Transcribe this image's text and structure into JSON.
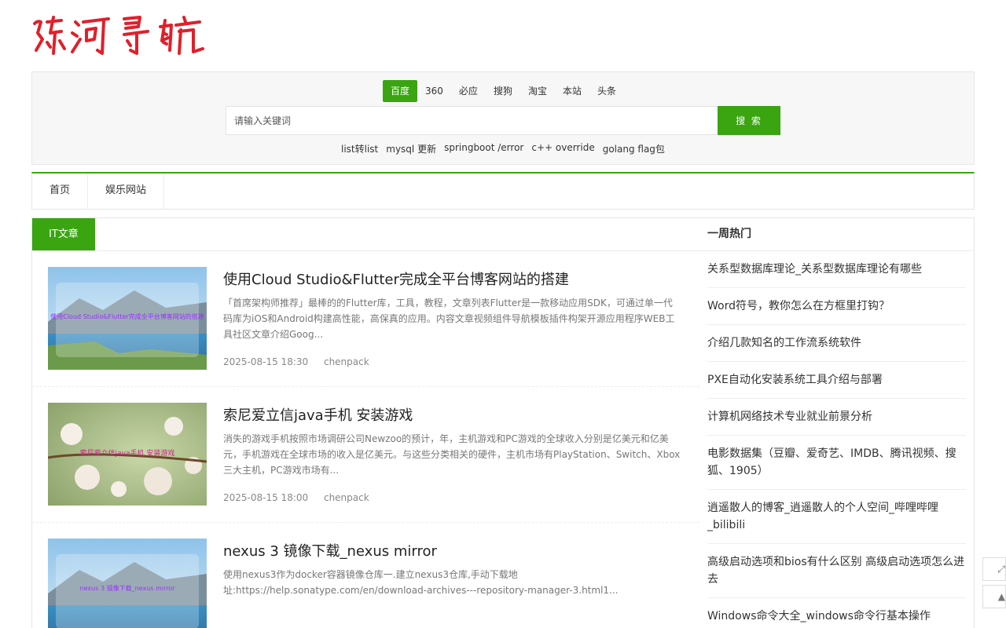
{
  "logo": {
    "text": "陈河导航",
    "color": "#e0202a"
  },
  "search": {
    "engines": [
      "百度",
      "360",
      "必应",
      "搜狗",
      "淘宝",
      "本站",
      "头条"
    ],
    "active_engine": 0,
    "placeholder": "请输入关键词",
    "button_label": "搜 索",
    "hot_keywords": [
      "list转list",
      "mysql 更新",
      "springboot /error",
      "c++ override",
      "golang flag包"
    ]
  },
  "nav": {
    "items": [
      "首页",
      "娱乐网站"
    ]
  },
  "main": {
    "tab_label": "IT文章",
    "articles": [
      {
        "title": "使用Cloud Studio&Flutter完成全平台博客网站的搭建",
        "desc": "「首席架构师推荐」最棒的的Flutter库，工具，教程，文章列表Flutter是一款移动应用SDK，可通过单一代码库为iOS和Android构建高性能，高保真的应用。内容文章视频组件导航模板插件构架开源应用程序WEB工具社区文章介绍Goog...",
        "date": "2025-08-15 18:30",
        "author": "chenpack",
        "thumb_label": "使用Cloud Studio&Flutter完成全平台博客网站的搭建"
      },
      {
        "title": "索尼爱立信java手机 安装游戏",
        "desc": "消失的游戏手机按照市场调研公司Newzoo的预计，年，主机游戏和PC游戏的全球收入分别是亿美元和亿美元，手机游戏在全球市场的收入是亿美元。与这些分类相关的硬件，主机市场有PlayStation、Switch、Xbox三大主机，PC游戏市场有...",
        "date": "2025-08-15 18:00",
        "author": "chenpack",
        "thumb_label": "索尼爱立信java手机 安装游戏"
      },
      {
        "title": "nexus 3 镜像下载_nexus mirror",
        "desc": "使用nexus3作为docker容器镜像仓库一.建立nexus3仓库,手动下载地址:https://help.sonatype.com/en/download-archives---repository-manager-3.html1...",
        "date": "",
        "author": "",
        "thumb_label": "nexus 3 镜像下载_nexus mirror"
      }
    ]
  },
  "sidebar": {
    "title": "一周热门",
    "items": [
      "关系型数据库理论_关系型数据库理论有哪些",
      "Word符号，教你怎么在方框里打钩？",
      "介绍几款知名的工作流系统软件",
      "PXE自动化安装系统工具介绍与部署",
      "计算机网络技术专业就业前景分析",
      "电影数据集（豆瓣、爱奇艺、IMDB、腾讯视频、搜狐、1905）",
      "逍遥散人的博客_逍遥散人的个人空间_哔哩哔哩_bilibili",
      "高级启动选项和bios有什么区别 高级启动选项怎么进去",
      "Windows命令大全_windows命令行基本操作"
    ]
  },
  "colors": {
    "accent": "#3aa511"
  }
}
